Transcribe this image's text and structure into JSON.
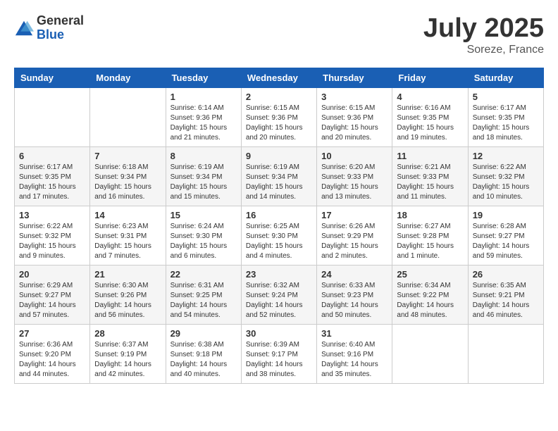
{
  "logo": {
    "general": "General",
    "blue": "Blue"
  },
  "title": {
    "month_year": "July 2025",
    "location": "Soreze, France"
  },
  "headers": [
    "Sunday",
    "Monday",
    "Tuesday",
    "Wednesday",
    "Thursday",
    "Friday",
    "Saturday"
  ],
  "weeks": [
    [
      {
        "day": "",
        "info": ""
      },
      {
        "day": "",
        "info": ""
      },
      {
        "day": "1",
        "info": "Sunrise: 6:14 AM\nSunset: 9:36 PM\nDaylight: 15 hours\nand 21 minutes."
      },
      {
        "day": "2",
        "info": "Sunrise: 6:15 AM\nSunset: 9:36 PM\nDaylight: 15 hours\nand 20 minutes."
      },
      {
        "day": "3",
        "info": "Sunrise: 6:15 AM\nSunset: 9:36 PM\nDaylight: 15 hours\nand 20 minutes."
      },
      {
        "day": "4",
        "info": "Sunrise: 6:16 AM\nSunset: 9:35 PM\nDaylight: 15 hours\nand 19 minutes."
      },
      {
        "day": "5",
        "info": "Sunrise: 6:17 AM\nSunset: 9:35 PM\nDaylight: 15 hours\nand 18 minutes."
      }
    ],
    [
      {
        "day": "6",
        "info": "Sunrise: 6:17 AM\nSunset: 9:35 PM\nDaylight: 15 hours\nand 17 minutes."
      },
      {
        "day": "7",
        "info": "Sunrise: 6:18 AM\nSunset: 9:34 PM\nDaylight: 15 hours\nand 16 minutes."
      },
      {
        "day": "8",
        "info": "Sunrise: 6:19 AM\nSunset: 9:34 PM\nDaylight: 15 hours\nand 15 minutes."
      },
      {
        "day": "9",
        "info": "Sunrise: 6:19 AM\nSunset: 9:34 PM\nDaylight: 15 hours\nand 14 minutes."
      },
      {
        "day": "10",
        "info": "Sunrise: 6:20 AM\nSunset: 9:33 PM\nDaylight: 15 hours\nand 13 minutes."
      },
      {
        "day": "11",
        "info": "Sunrise: 6:21 AM\nSunset: 9:33 PM\nDaylight: 15 hours\nand 11 minutes."
      },
      {
        "day": "12",
        "info": "Sunrise: 6:22 AM\nSunset: 9:32 PM\nDaylight: 15 hours\nand 10 minutes."
      }
    ],
    [
      {
        "day": "13",
        "info": "Sunrise: 6:22 AM\nSunset: 9:32 PM\nDaylight: 15 hours\nand 9 minutes."
      },
      {
        "day": "14",
        "info": "Sunrise: 6:23 AM\nSunset: 9:31 PM\nDaylight: 15 hours\nand 7 minutes."
      },
      {
        "day": "15",
        "info": "Sunrise: 6:24 AM\nSunset: 9:30 PM\nDaylight: 15 hours\nand 6 minutes."
      },
      {
        "day": "16",
        "info": "Sunrise: 6:25 AM\nSunset: 9:30 PM\nDaylight: 15 hours\nand 4 minutes."
      },
      {
        "day": "17",
        "info": "Sunrise: 6:26 AM\nSunset: 9:29 PM\nDaylight: 15 hours\nand 2 minutes."
      },
      {
        "day": "18",
        "info": "Sunrise: 6:27 AM\nSunset: 9:28 PM\nDaylight: 15 hours\nand 1 minute."
      },
      {
        "day": "19",
        "info": "Sunrise: 6:28 AM\nSunset: 9:27 PM\nDaylight: 14 hours\nand 59 minutes."
      }
    ],
    [
      {
        "day": "20",
        "info": "Sunrise: 6:29 AM\nSunset: 9:27 PM\nDaylight: 14 hours\nand 57 minutes."
      },
      {
        "day": "21",
        "info": "Sunrise: 6:30 AM\nSunset: 9:26 PM\nDaylight: 14 hours\nand 56 minutes."
      },
      {
        "day": "22",
        "info": "Sunrise: 6:31 AM\nSunset: 9:25 PM\nDaylight: 14 hours\nand 54 minutes."
      },
      {
        "day": "23",
        "info": "Sunrise: 6:32 AM\nSunset: 9:24 PM\nDaylight: 14 hours\nand 52 minutes."
      },
      {
        "day": "24",
        "info": "Sunrise: 6:33 AM\nSunset: 9:23 PM\nDaylight: 14 hours\nand 50 minutes."
      },
      {
        "day": "25",
        "info": "Sunrise: 6:34 AM\nSunset: 9:22 PM\nDaylight: 14 hours\nand 48 minutes."
      },
      {
        "day": "26",
        "info": "Sunrise: 6:35 AM\nSunset: 9:21 PM\nDaylight: 14 hours\nand 46 minutes."
      }
    ],
    [
      {
        "day": "27",
        "info": "Sunrise: 6:36 AM\nSunset: 9:20 PM\nDaylight: 14 hours\nand 44 minutes."
      },
      {
        "day": "28",
        "info": "Sunrise: 6:37 AM\nSunset: 9:19 PM\nDaylight: 14 hours\nand 42 minutes."
      },
      {
        "day": "29",
        "info": "Sunrise: 6:38 AM\nSunset: 9:18 PM\nDaylight: 14 hours\nand 40 minutes."
      },
      {
        "day": "30",
        "info": "Sunrise: 6:39 AM\nSunset: 9:17 PM\nDaylight: 14 hours\nand 38 minutes."
      },
      {
        "day": "31",
        "info": "Sunrise: 6:40 AM\nSunset: 9:16 PM\nDaylight: 14 hours\nand 35 minutes."
      },
      {
        "day": "",
        "info": ""
      },
      {
        "day": "",
        "info": ""
      }
    ]
  ]
}
